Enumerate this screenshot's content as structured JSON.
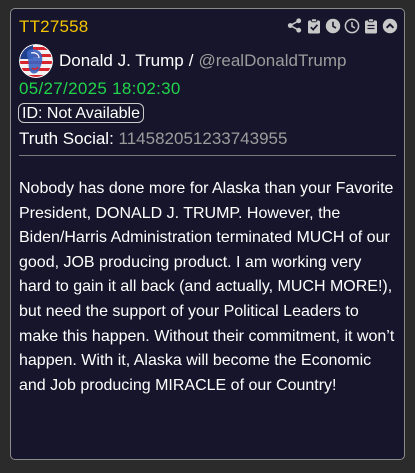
{
  "post": {
    "id": "TT27558",
    "author_name": "Donald J. Trump",
    "author_separator": "/",
    "author_handle": "@realDonaldTrump",
    "timestamp": "05/27/2025 18:02:30",
    "id_status": "ID: Not Available",
    "source_label": "Truth Social:",
    "source_id": "114582051233743955",
    "body": "Nobody has done more for Alaska than your Favorite President, DONALD J. TRUMP. However, the Biden/Harris Administration terminated MUCH of our good, JOB producing product. I am working very hard to gain it all back (and actually, MUCH MORE!), but need the support of your Political Leaders to make this happen. Without their commitment, it won’t happen. With it, Alaska will become the Economic and Job producing MIRACLE of our Country!"
  },
  "toolbar": {
    "icons": [
      "share-icon",
      "clipboard-check-icon",
      "clock-icon",
      "clock-icon",
      "clipboard-icon",
      "chevron-up-circle-icon"
    ]
  },
  "colors": {
    "id": "#f5c400",
    "timestamp": "#22d44c",
    "card_background": "#16152b",
    "muted_text": "#9c9c9c"
  }
}
